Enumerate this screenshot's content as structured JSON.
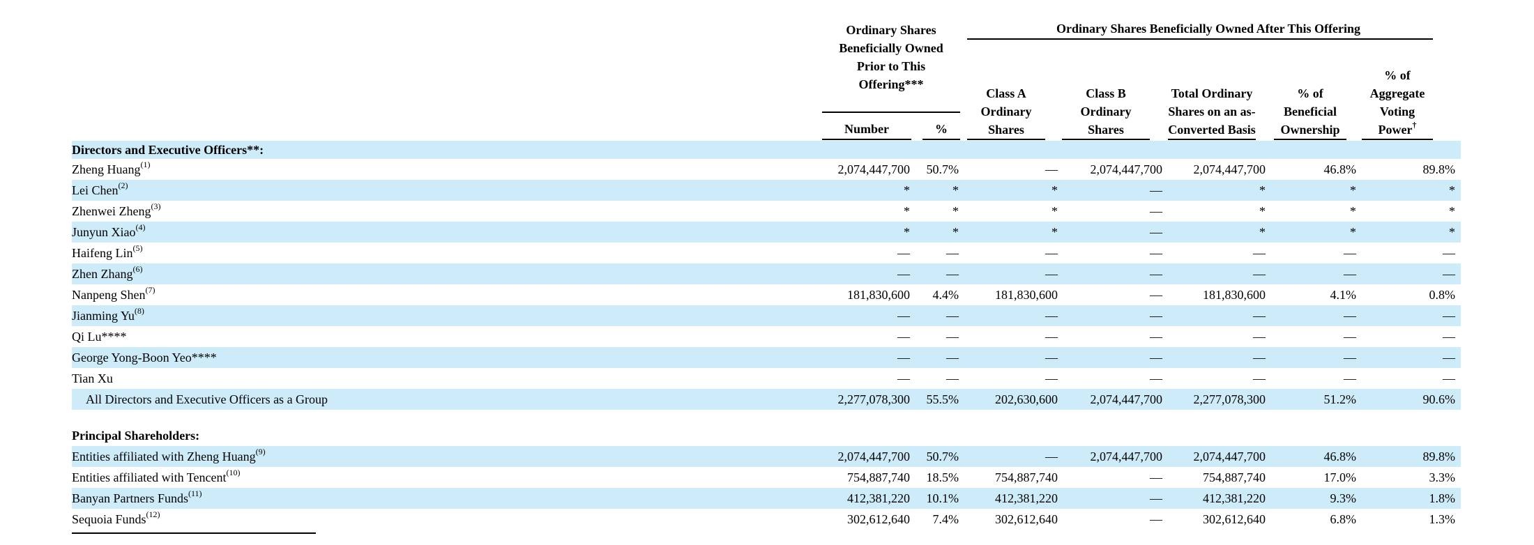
{
  "header": {
    "prior_group": "Ordinary Shares Beneficially Owned Prior to This Offering***",
    "after_group": "Ordinary Shares Beneficially Owned After This Offering",
    "number": "Number",
    "pct": "%",
    "class_a": "Class A Ordinary Shares",
    "class_b": "Class B Ordinary Shares",
    "total": "Total Ordinary Shares on an as-Converted Basis",
    "beneficial": "% of Beneficial Ownership",
    "voting": "% of Aggregate Voting Power",
    "voting_mark": "†"
  },
  "sections": {
    "directors": "Directors and Executive Officers**:",
    "principal": "Principal Shareholders:"
  },
  "directors": [
    {
      "name": "Zheng Huang",
      "note": "(1)",
      "cells": [
        "2,074,447,700",
        "50.7%",
        "—",
        "2,074,447,700",
        "2,074,447,700",
        "46.8%",
        "89.8%"
      ]
    },
    {
      "name": "Lei Chen",
      "note": "(2)",
      "cells": [
        "*",
        "*",
        "*",
        "—",
        "*",
        "*",
        "*"
      ]
    },
    {
      "name": "Zhenwei Zheng",
      "note": "(3)",
      "cells": [
        "*",
        "*",
        "*",
        "—",
        "*",
        "*",
        "*"
      ]
    },
    {
      "name": "Junyun Xiao",
      "note": "(4)",
      "cells": [
        "*",
        "*",
        "*",
        "—",
        "*",
        "*",
        "*"
      ]
    },
    {
      "name": "Haifeng Lin",
      "note": "(5)",
      "cells": [
        "—",
        "—",
        "—",
        "—",
        "—",
        "—",
        "—"
      ]
    },
    {
      "name": "Zhen Zhang",
      "note": "(6)",
      "cells": [
        "—",
        "—",
        "—",
        "—",
        "—",
        "—",
        "—"
      ]
    },
    {
      "name": "Nanpeng Shen",
      "note": "(7)",
      "cells": [
        "181,830,600",
        "4.4%",
        "181,830,600",
        "—",
        "181,830,600",
        "4.1%",
        "0.8%"
      ]
    },
    {
      "name": "Jianming Yu",
      "note": "(8)",
      "cells": [
        "—",
        "—",
        "—",
        "—",
        "—",
        "—",
        "—"
      ]
    },
    {
      "name": "Qi Lu****",
      "note": "",
      "cells": [
        "—",
        "—",
        "—",
        "—",
        "—",
        "—",
        "—"
      ]
    },
    {
      "name": "George Yong-Boon Yeo****",
      "note": "",
      "cells": [
        "—",
        "—",
        "—",
        "—",
        "—",
        "—",
        "—"
      ]
    },
    {
      "name": "Tian Xu",
      "note": "",
      "cells": [
        "—",
        "—",
        "—",
        "—",
        "—",
        "—",
        "—"
      ]
    }
  ],
  "group_total": {
    "name": "All Directors and Executive Officers as a Group",
    "cells": [
      "2,277,078,300",
      "55.5%",
      "202,630,600",
      "2,074,447,700",
      "2,277,078,300",
      "51.2%",
      "90.6%"
    ]
  },
  "principal": [
    {
      "name": "Entities affiliated with Zheng Huang",
      "note": "(9)",
      "cells": [
        "2,074,447,700",
        "50.7%",
        "—",
        "2,074,447,700",
        "2,074,447,700",
        "46.8%",
        "89.8%"
      ]
    },
    {
      "name": "Entities affiliated with Tencent",
      "note": "(10)",
      "cells": [
        "754,887,740",
        "18.5%",
        "754,887,740",
        "—",
        "754,887,740",
        "17.0%",
        "3.3%"
      ]
    },
    {
      "name": "Banyan Partners Funds",
      "note": "(11)",
      "cells": [
        "412,381,220",
        "10.1%",
        "412,381,220",
        "—",
        "412,381,220",
        "9.3%",
        "1.8%"
      ]
    },
    {
      "name": "Sequoia Funds",
      "note": "(12)",
      "cells": [
        "302,612,640",
        "7.4%",
        "302,612,640",
        "—",
        "302,612,640",
        "6.8%",
        "1.3%"
      ]
    }
  ]
}
